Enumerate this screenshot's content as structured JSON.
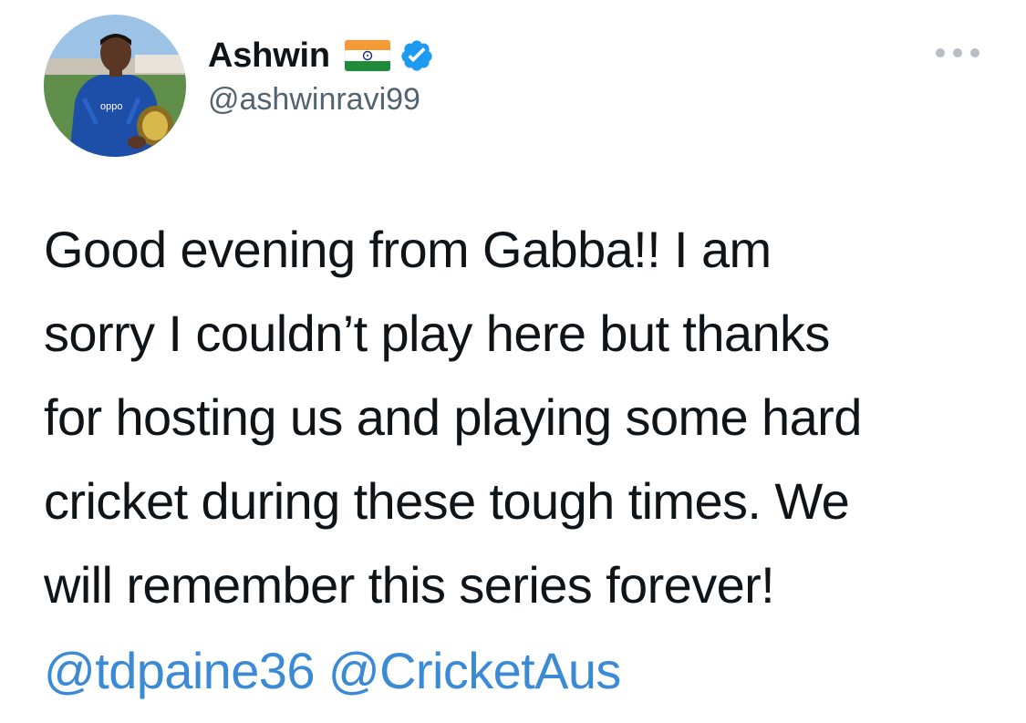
{
  "user": {
    "display_name": "Ashwin",
    "handle": "@ashwinravi99",
    "flag_icon": "india-flag-icon",
    "verified_icon": "verified-badge-icon",
    "verified_color": "#1d9bf0"
  },
  "tweet": {
    "lines": [
      "Good evening from Gabba!! I am",
      "sorry I couldn’t play here but thanks",
      "for hosting us and playing some hard",
      "cricket during these tough times. We",
      "will remember this series forever!"
    ],
    "mentions": [
      "@tdpaine36",
      "@CricketAus"
    ],
    "mention_color": "#3b8ad6"
  },
  "menu": {
    "icon": "more-options-icon"
  }
}
